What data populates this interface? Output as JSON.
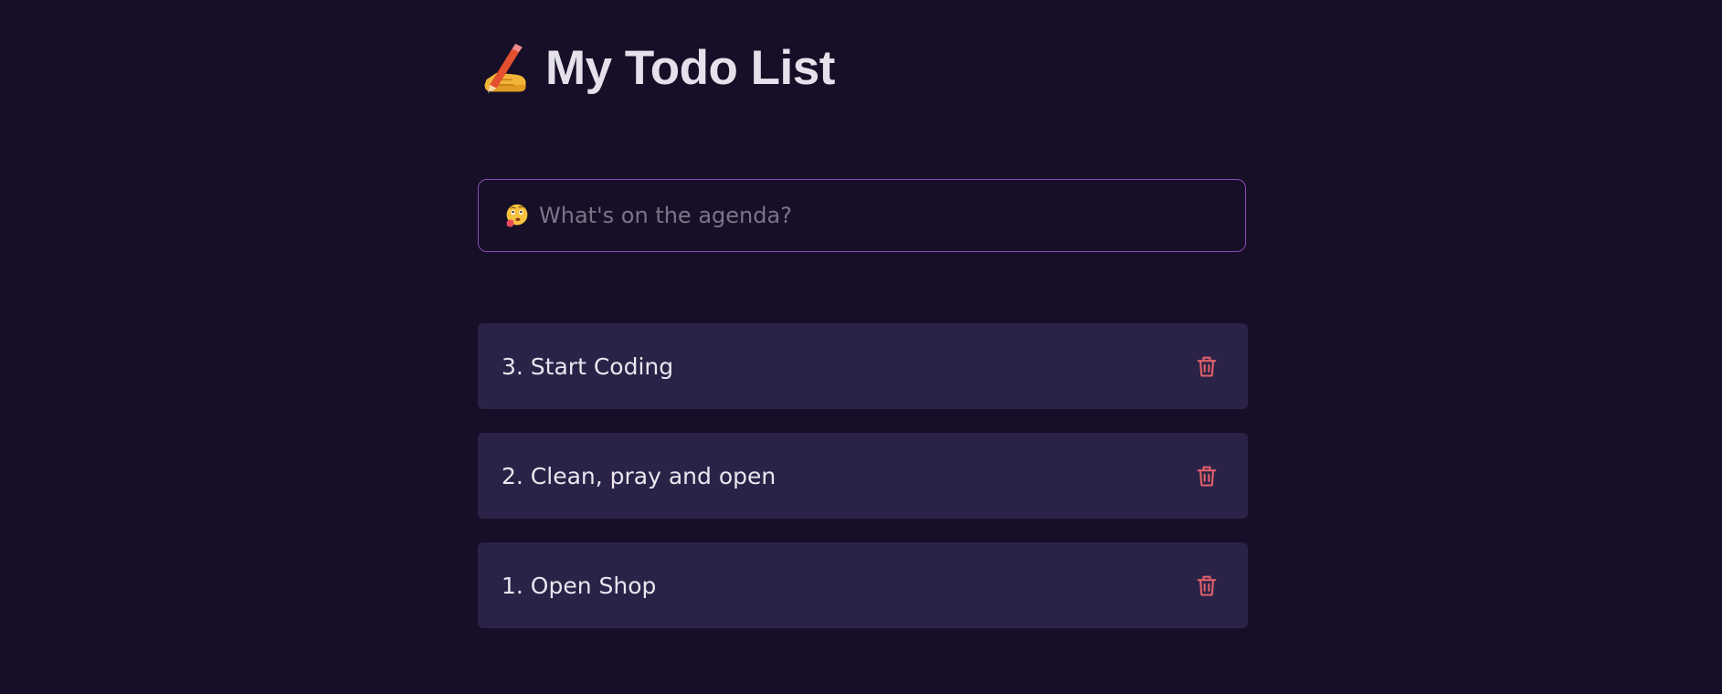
{
  "header": {
    "emoji_icon": "writing-hand-icon",
    "title": "My Todo List"
  },
  "input": {
    "emoji_icon": "thinking-face-icon",
    "placeholder": "What's on the agenda?",
    "value": ""
  },
  "todos": [
    {
      "label": "3. Start Coding",
      "delete_icon": "trash-icon"
    },
    {
      "label": "2. Clean, pray and open",
      "delete_icon": "trash-icon"
    },
    {
      "label": "1. Open Shop",
      "delete_icon": "trash-icon"
    }
  ],
  "colors": {
    "background": "#170f28",
    "card": "#2b2347",
    "input_border": "#8a4bb4",
    "delete_icon": "#e0606a",
    "text": "#e9e6ef"
  }
}
